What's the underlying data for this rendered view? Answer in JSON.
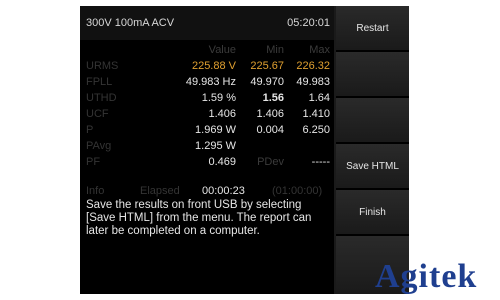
{
  "status_bar": {
    "left_text": "300V  100mA  ACV",
    "time": "05:20:01"
  },
  "table": {
    "headers": [
      "Value",
      "Min",
      "Max"
    ],
    "rows": [
      {
        "label": "URMS",
        "value": "225.88 V",
        "min": "225.67",
        "max": "226.32"
      },
      {
        "label": "FPLL",
        "value": "49.983 Hz",
        "min": "49.970",
        "max": "49.983"
      },
      {
        "label": "UTHD",
        "value": "1.59 %",
        "min": "1.56",
        "max": "1.64"
      },
      {
        "label": "UCF",
        "value": "1.406",
        "min": "1.406",
        "max": "1.410"
      },
      {
        "label": "P",
        "value": "1.969 W",
        "min": "0.004",
        "max": "6.250"
      },
      {
        "label": "PAvg",
        "value": "1.295 W",
        "min": "",
        "max": ""
      },
      {
        "label": "PF",
        "value": "0.469",
        "min": "PDev",
        "max": "-----"
      }
    ]
  },
  "info": {
    "label": "Info",
    "elapsed_label": "Elapsed",
    "elapsed_value": "00:00:23",
    "elapsed_total": "(01:00:00)"
  },
  "message": "Save the results on front USB by selecting [Save HTML] from the menu. The report can later be completed on a computer.",
  "softkeys": {
    "restart": "Restart",
    "save_html": "Save HTML",
    "finish": "Finish"
  },
  "watermark": "Agitek",
  "colors": {
    "highlight": "#e0a030",
    "text": "#e6e6e6",
    "dim": "#343434",
    "brand": "#1f3f8f"
  }
}
